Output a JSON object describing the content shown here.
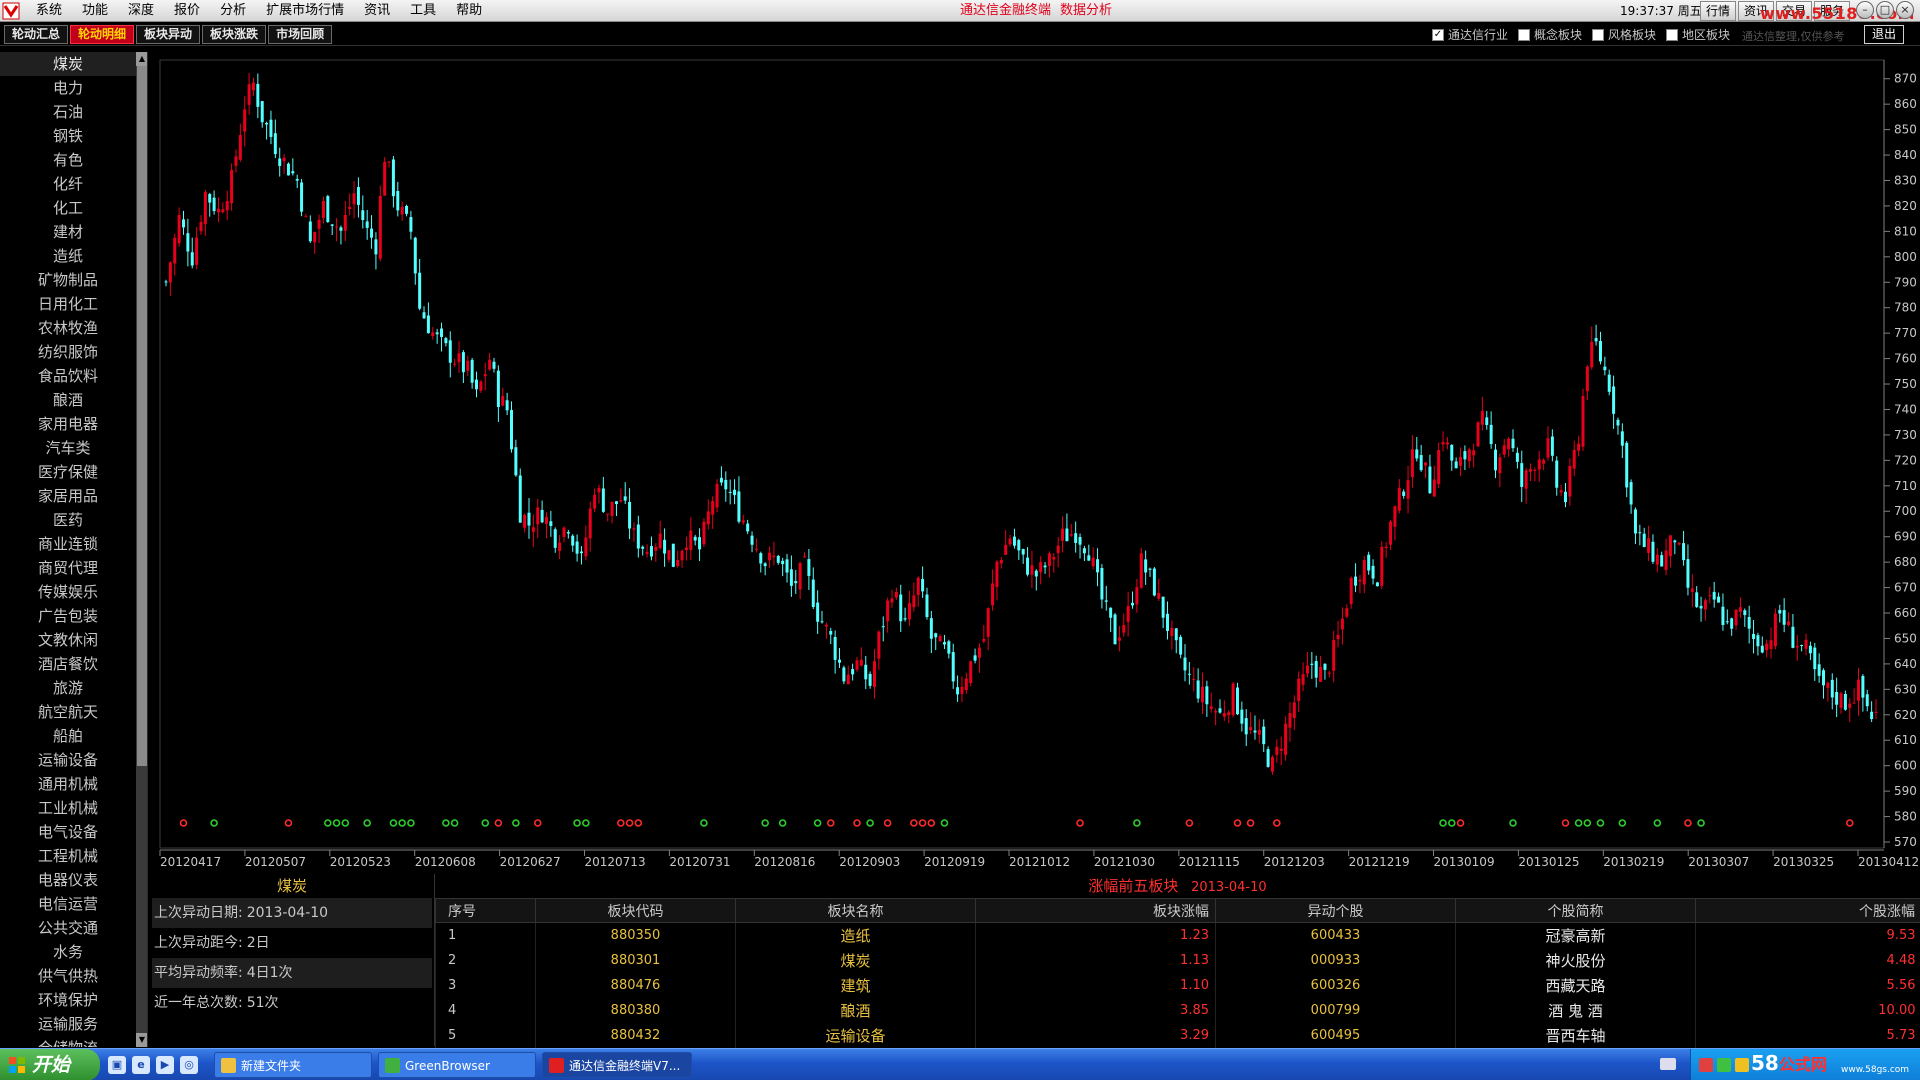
{
  "menubar": {
    "items": [
      "系统",
      "功能",
      "深度",
      "报价",
      "分析",
      "扩展市场行情",
      "资讯",
      "工具",
      "帮助"
    ],
    "title": "通达信金融终端",
    "subtitle": "数据分析",
    "clock": "19:37:37 周五",
    "buttons": [
      "行情",
      "资讯",
      "交易",
      "服务"
    ],
    "watermark": "www.55188.com"
  },
  "toolbar": {
    "tabs": [
      "轮动汇总",
      "轮动明细",
      "板块异动",
      "板块涨跌",
      "市场回顾"
    ],
    "active_tab": 1,
    "filters": [
      {
        "label": "通达信行业",
        "checked": true
      },
      {
        "label": "概念板块",
        "checked": false
      },
      {
        "label": "风格板块",
        "checked": false
      },
      {
        "label": "地区板块",
        "checked": false
      }
    ],
    "disclaimer": "通达信整理,仅供参考",
    "exit_label": "退出"
  },
  "sidebar": {
    "selected": 0,
    "items": [
      "煤炭",
      "电力",
      "石油",
      "钢铁",
      "有色",
      "化纤",
      "化工",
      "建材",
      "造纸",
      "矿物制品",
      "日用化工",
      "农林牧渔",
      "纺织服饰",
      "食品饮料",
      "酿酒",
      "家用电器",
      "汽车类",
      "医疗保健",
      "家居用品",
      "医药",
      "商业连锁",
      "商贸代理",
      "传媒娱乐",
      "广告包装",
      "文教休闲",
      "酒店餐饮",
      "旅游",
      "航空航天",
      "船舶",
      "运输设备",
      "通用机械",
      "工业机械",
      "电气设备",
      "工程机械",
      "电器仪表",
      "电信运营",
      "公共交通",
      "水务",
      "供气供热",
      "环境保护",
      "运输服务",
      "仓储物流"
    ]
  },
  "chart_data": {
    "type": "candlestick",
    "ylim": [
      570,
      875
    ],
    "yticks": [
      570,
      580,
      590,
      600,
      610,
      620,
      630,
      640,
      650,
      660,
      670,
      680,
      690,
      700,
      710,
      720,
      730,
      740,
      750,
      760,
      770,
      780,
      790,
      800,
      810,
      820,
      830,
      840,
      850,
      860,
      870
    ],
    "xticks": [
      "20120417",
      "20120507",
      "20120523",
      "20120608",
      "20120627",
      "20120713",
      "20120731",
      "20120816",
      "20120903",
      "20120919",
      "20121012",
      "20121030",
      "20121115",
      "20121203",
      "20121219",
      "20130109",
      "20130125",
      "20130219",
      "20130307",
      "20130325",
      "20130412"
    ],
    "close_path": [
      [
        0,
        790
      ],
      [
        3,
        815
      ],
      [
        6,
        800
      ],
      [
        9,
        825
      ],
      [
        12,
        818
      ],
      [
        15,
        830
      ],
      [
        18,
        860
      ],
      [
        20,
        868
      ],
      [
        22,
        855
      ],
      [
        26,
        840
      ],
      [
        30,
        830
      ],
      [
        33,
        805
      ],
      [
        36,
        820
      ],
      [
        40,
        810
      ],
      [
        43,
        825
      ],
      [
        46,
        810
      ],
      [
        48,
        805
      ],
      [
        50,
        840
      ],
      [
        53,
        820
      ],
      [
        56,
        810
      ],
      [
        58,
        780
      ],
      [
        61,
        770
      ],
      [
        63,
        765
      ],
      [
        66,
        760
      ],
      [
        69,
        755
      ],
      [
        71,
        745
      ],
      [
        74,
        760
      ],
      [
        76,
        745
      ],
      [
        78,
        740
      ],
      [
        81,
        700
      ],
      [
        83,
        695
      ],
      [
        86,
        700
      ],
      [
        89,
        690
      ],
      [
        92,
        695
      ],
      [
        95,
        680
      ],
      [
        98,
        710
      ],
      [
        101,
        700
      ],
      [
        104,
        705
      ],
      [
        107,
        690
      ],
      [
        110,
        685
      ],
      [
        113,
        690
      ],
      [
        116,
        680
      ],
      [
        119,
        690
      ],
      [
        122,
        685
      ],
      [
        125,
        705
      ],
      [
        128,
        710
      ],
      [
        131,
        700
      ],
      [
        134,
        690
      ],
      [
        137,
        680
      ],
      [
        140,
        682
      ],
      [
        143,
        670
      ],
      [
        146,
        678
      ],
      [
        149,
        660
      ],
      [
        152,
        650
      ],
      [
        155,
        635
      ],
      [
        158,
        640
      ],
      [
        161,
        632
      ],
      [
        163,
        650
      ],
      [
        166,
        670
      ],
      [
        169,
        655
      ],
      [
        172,
        672
      ],
      [
        175,
        650
      ],
      [
        178,
        645
      ],
      [
        181,
        630
      ],
      [
        184,
        640
      ],
      [
        187,
        650
      ],
      [
        190,
        680
      ],
      [
        193,
        690
      ],
      [
        196,
        680
      ],
      [
        199,
        675
      ],
      [
        202,
        680
      ],
      [
        205,
        690
      ],
      [
        208,
        692
      ],
      [
        211,
        685
      ],
      [
        214,
        665
      ],
      [
        217,
        650
      ],
      [
        220,
        660
      ],
      [
        223,
        680
      ],
      [
        226,
        670
      ],
      [
        229,
        655
      ],
      [
        232,
        640
      ],
      [
        235,
        632
      ],
      [
        238,
        625
      ],
      [
        241,
        620
      ],
      [
        244,
        628
      ],
      [
        247,
        615
      ],
      [
        250,
        610
      ],
      [
        253,
        600
      ],
      [
        256,
        615
      ],
      [
        259,
        630
      ],
      [
        262,
        640
      ],
      [
        265,
        635
      ],
      [
        268,
        650
      ],
      [
        271,
        672
      ],
      [
        274,
        680
      ],
      [
        277,
        675
      ],
      [
        280,
        695
      ],
      [
        283,
        710
      ],
      [
        286,
        725
      ],
      [
        289,
        710
      ],
      [
        292,
        730
      ],
      [
        295,
        715
      ],
      [
        298,
        725
      ],
      [
        301,
        735
      ],
      [
        304,
        720
      ],
      [
        307,
        730
      ],
      [
        310,
        710
      ],
      [
        313,
        720
      ],
      [
        316,
        725
      ],
      [
        318,
        710
      ],
      [
        320,
        705
      ],
      [
        323,
        730
      ],
      [
        325,
        760
      ],
      [
        327,
        765
      ],
      [
        330,
        750
      ],
      [
        333,
        725
      ],
      [
        336,
        690
      ],
      [
        339,
        685
      ],
      [
        342,
        680
      ],
      [
        345,
        690
      ],
      [
        348,
        670
      ],
      [
        351,
        660
      ],
      [
        354,
        665
      ],
      [
        357,
        655
      ],
      [
        360,
        660
      ],
      [
        363,
        650
      ],
      [
        366,
        648
      ],
      [
        369,
        660
      ],
      [
        372,
        650
      ],
      [
        375,
        645
      ],
      [
        378,
        632
      ],
      [
        381,
        628
      ],
      [
        384,
        625
      ],
      [
        387,
        630
      ],
      [
        390,
        620
      ]
    ],
    "markers": [
      {
        "t": 4,
        "c": "red"
      },
      {
        "t": 11,
        "c": "green"
      },
      {
        "t": 28,
        "c": "red"
      },
      {
        "t": 37,
        "c": "green"
      },
      {
        "t": 39,
        "c": "green"
      },
      {
        "t": 41,
        "c": "green"
      },
      {
        "t": 46,
        "c": "green"
      },
      {
        "t": 52,
        "c": "green"
      },
      {
        "t": 54,
        "c": "green"
      },
      {
        "t": 56,
        "c": "green"
      },
      {
        "t": 64,
        "c": "green"
      },
      {
        "t": 66,
        "c": "green"
      },
      {
        "t": 73,
        "c": "green"
      },
      {
        "t": 76,
        "c": "red"
      },
      {
        "t": 80,
        "c": "green"
      },
      {
        "t": 85,
        "c": "red"
      },
      {
        "t": 94,
        "c": "green"
      },
      {
        "t": 96,
        "c": "green"
      },
      {
        "t": 104,
        "c": "red"
      },
      {
        "t": 106,
        "c": "red"
      },
      {
        "t": 108,
        "c": "red"
      },
      {
        "t": 123,
        "c": "green"
      },
      {
        "t": 137,
        "c": "green"
      },
      {
        "t": 141,
        "c": "green"
      },
      {
        "t": 149,
        "c": "green"
      },
      {
        "t": 152,
        "c": "red"
      },
      {
        "t": 158,
        "c": "red"
      },
      {
        "t": 161,
        "c": "green"
      },
      {
        "t": 165,
        "c": "red"
      },
      {
        "t": 171,
        "c": "red"
      },
      {
        "t": 173,
        "c": "red"
      },
      {
        "t": 175,
        "c": "red"
      },
      {
        "t": 178,
        "c": "green"
      },
      {
        "t": 209,
        "c": "red"
      },
      {
        "t": 222,
        "c": "green"
      },
      {
        "t": 234,
        "c": "red"
      },
      {
        "t": 245,
        "c": "red"
      },
      {
        "t": 248,
        "c": "red"
      },
      {
        "t": 254,
        "c": "red"
      },
      {
        "t": 292,
        "c": "green"
      },
      {
        "t": 294,
        "c": "green"
      },
      {
        "t": 296,
        "c": "red"
      },
      {
        "t": 308,
        "c": "green"
      },
      {
        "t": 320,
        "c": "red"
      },
      {
        "t": 323,
        "c": "green"
      },
      {
        "t": 325,
        "c": "green"
      },
      {
        "t": 328,
        "c": "green"
      },
      {
        "t": 333,
        "c": "green"
      },
      {
        "t": 341,
        "c": "green"
      },
      {
        "t": 348,
        "c": "red"
      },
      {
        "t": 351,
        "c": "green"
      },
      {
        "t": 385,
        "c": "red"
      }
    ]
  },
  "info_panel": {
    "title": "煤炭",
    "rows": [
      {
        "label": "上次异动日期:",
        "value": "2013-04-10"
      },
      {
        "label": "上次异动距今:",
        "value": "2日"
      },
      {
        "label": "平均异动频率:",
        "value": "4日1次"
      },
      {
        "label": "近一年总次数:",
        "value": "51次"
      }
    ]
  },
  "table": {
    "title": "涨幅前五板块",
    "date": "2013-04-10",
    "headers": [
      "序号",
      "板块代码",
      "板块名称",
      "板块涨幅",
      "异动个股",
      "个股简称",
      "个股涨幅"
    ],
    "rows": [
      [
        "1",
        "880350",
        "造纸",
        "1.23",
        "600433",
        "冠豪高新",
        "9.53"
      ],
      [
        "2",
        "880301",
        "煤炭",
        "1.13",
        "000933",
        "神火股份",
        "4.48"
      ],
      [
        "3",
        "880476",
        "建筑",
        "1.10",
        "600326",
        "西藏天路",
        "5.56"
      ],
      [
        "4",
        "880380",
        "酿酒",
        "3.85",
        "000799",
        "酒 鬼 酒",
        "10.00"
      ],
      [
        "5",
        "880432",
        "运输设备",
        "3.29",
        "600495",
        "晋西车轴",
        "5.73"
      ]
    ]
  },
  "taskbar": {
    "start_label": "开始",
    "tasks": [
      "新建文件夹",
      "GreenBrowser",
      "通达信金融终端V7..."
    ],
    "brand": "58",
    "brand_cn": "公式网",
    "brand_url": "www.58gs.com"
  },
  "colors": {
    "up": "#e8001c",
    "down": "#54ffff",
    "accent": "#c0001a",
    "label": "#e8c040"
  }
}
